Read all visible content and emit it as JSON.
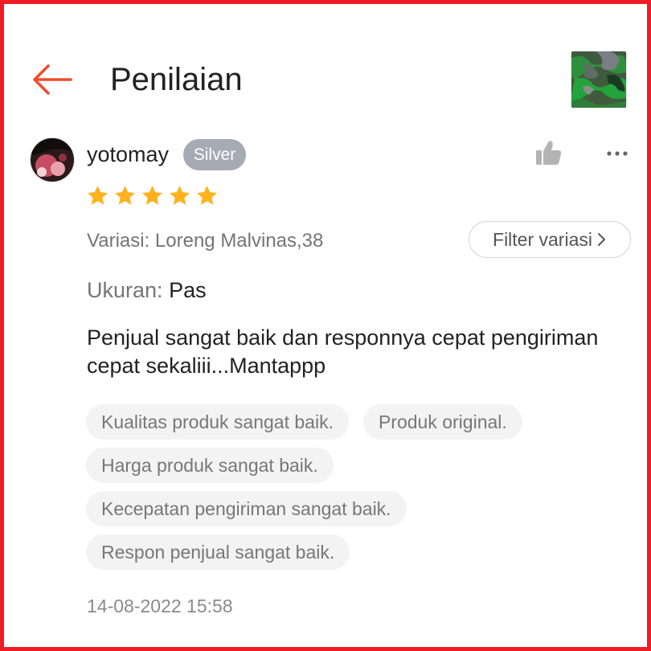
{
  "header": {
    "title": "Penilaian"
  },
  "review": {
    "username": "yotomay",
    "badge": "Silver",
    "rating": 5,
    "variation": "Variasi: Loreng Malvinas,38",
    "filter_label": "Filter variasi",
    "size_label": "Ukuran:",
    "size_value": "Pas",
    "text": "Penjual sangat baik dan responnya cepat pengiriman cepat sekaliii...Mantappp",
    "tags": [
      "Kualitas produk sangat baik.",
      "Produk original.",
      "Harga produk sangat baik.",
      "Kecepatan pengiriman sangat baik.",
      "Respon penjual sangat baik."
    ],
    "timestamp": "14-08-2022 15:58"
  },
  "colors": {
    "accent": "#ee4d2d",
    "star": "#ffb21d",
    "badge": "#a5aab4",
    "border": "#ee1c25"
  },
  "icons": {
    "back": "arrow-left-icon",
    "like": "thumbs-up-icon",
    "more": "more-dots-icon",
    "filter_chevron": "chevron-right-icon",
    "star": "star-icon"
  }
}
